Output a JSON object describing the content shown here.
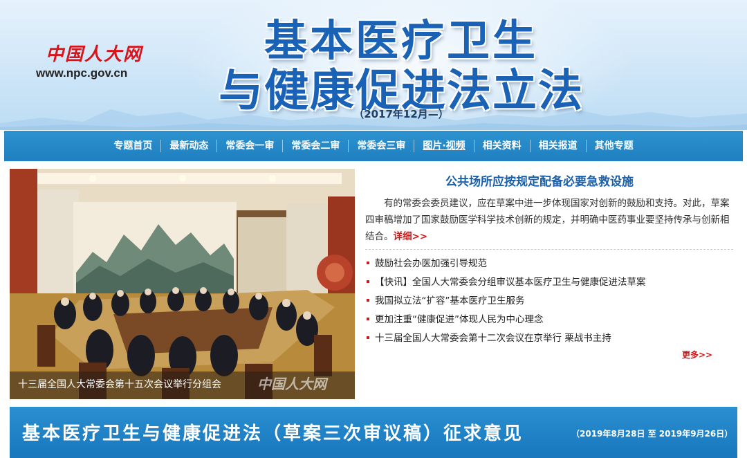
{
  "header": {
    "logo_name": "中国人大网",
    "logo_url": "www.npc.gov.cn",
    "title_line1": "基本医疗卫生",
    "title_line2": "与健康促进法立法",
    "date_range": "（2017年12月—）"
  },
  "nav": {
    "items": [
      {
        "label": "专题首页"
      },
      {
        "label": "最新动态"
      },
      {
        "label": "常委会一审"
      },
      {
        "label": "常委会二审"
      },
      {
        "label": "常委会三审"
      },
      {
        "label": "图片·视频"
      },
      {
        "label": "相关资料"
      },
      {
        "label": "相关报道"
      },
      {
        "label": "其他专题"
      }
    ]
  },
  "photo": {
    "caption": "十三届全国人大常委会第十五次会议举行分组会",
    "watermark": "中国人大网"
  },
  "featured": {
    "headline": "公共场所应按规定配备必要急救设施",
    "summary": "有的常委会委员建议，应在草案中进一步体现国家对创新的鼓励和支持。对此，草案四审稿增加了国家鼓励医学科学技术创新的规定，并明确中医药事业要坚持传承与创新相结合。",
    "detail_link": "详细>>"
  },
  "news": [
    {
      "title": "鼓励社会办医加强引导规范"
    },
    {
      "title": "【快讯】全国人大常委会分组审议基本医疗卫生与健康促进法草案"
    },
    {
      "title": "我国拟立法“扩容”基本医疗卫生服务"
    },
    {
      "title": "更加注重“健康促进”体现人民为中心理念"
    },
    {
      "title": "十三届全国人大常委会第十二次会议在京举行 栗战书主持"
    }
  ],
  "more_link": "更多>>",
  "banner": {
    "title": "基本医疗卫生与健康促进法（草案三次审议稿）征求意见",
    "date": "（2019年8月28日 至 2019年9月26日）"
  },
  "colors": {
    "nav_blue": "#2088c8",
    "title_blue": "#1a62b5",
    "accent_red": "#d01818"
  }
}
